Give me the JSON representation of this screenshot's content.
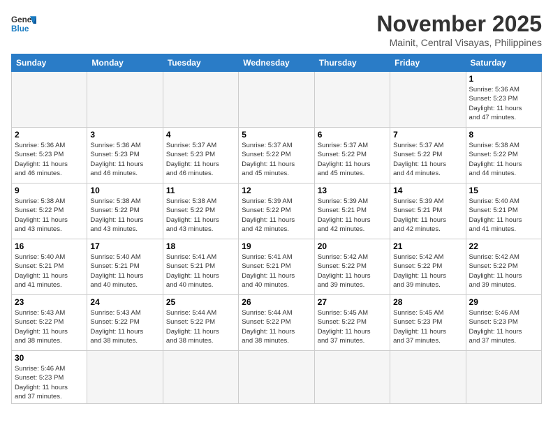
{
  "header": {
    "logo_general": "General",
    "logo_blue": "Blue",
    "month_title": "November 2025",
    "subtitle": "Mainit, Central Visayas, Philippines"
  },
  "weekdays": [
    "Sunday",
    "Monday",
    "Tuesday",
    "Wednesday",
    "Thursday",
    "Friday",
    "Saturday"
  ],
  "weeks": [
    [
      {
        "day": "",
        "info": ""
      },
      {
        "day": "",
        "info": ""
      },
      {
        "day": "",
        "info": ""
      },
      {
        "day": "",
        "info": ""
      },
      {
        "day": "",
        "info": ""
      },
      {
        "day": "",
        "info": ""
      },
      {
        "day": "1",
        "info": "Sunrise: 5:36 AM\nSunset: 5:23 PM\nDaylight: 11 hours\nand 47 minutes."
      }
    ],
    [
      {
        "day": "2",
        "info": "Sunrise: 5:36 AM\nSunset: 5:23 PM\nDaylight: 11 hours\nand 46 minutes."
      },
      {
        "day": "3",
        "info": "Sunrise: 5:36 AM\nSunset: 5:23 PM\nDaylight: 11 hours\nand 46 minutes."
      },
      {
        "day": "4",
        "info": "Sunrise: 5:37 AM\nSunset: 5:23 PM\nDaylight: 11 hours\nand 46 minutes."
      },
      {
        "day": "5",
        "info": "Sunrise: 5:37 AM\nSunset: 5:22 PM\nDaylight: 11 hours\nand 45 minutes."
      },
      {
        "day": "6",
        "info": "Sunrise: 5:37 AM\nSunset: 5:22 PM\nDaylight: 11 hours\nand 45 minutes."
      },
      {
        "day": "7",
        "info": "Sunrise: 5:37 AM\nSunset: 5:22 PM\nDaylight: 11 hours\nand 44 minutes."
      },
      {
        "day": "8",
        "info": "Sunrise: 5:38 AM\nSunset: 5:22 PM\nDaylight: 11 hours\nand 44 minutes."
      }
    ],
    [
      {
        "day": "9",
        "info": "Sunrise: 5:38 AM\nSunset: 5:22 PM\nDaylight: 11 hours\nand 43 minutes."
      },
      {
        "day": "10",
        "info": "Sunrise: 5:38 AM\nSunset: 5:22 PM\nDaylight: 11 hours\nand 43 minutes."
      },
      {
        "day": "11",
        "info": "Sunrise: 5:38 AM\nSunset: 5:22 PM\nDaylight: 11 hours\nand 43 minutes."
      },
      {
        "day": "12",
        "info": "Sunrise: 5:39 AM\nSunset: 5:22 PM\nDaylight: 11 hours\nand 42 minutes."
      },
      {
        "day": "13",
        "info": "Sunrise: 5:39 AM\nSunset: 5:21 PM\nDaylight: 11 hours\nand 42 minutes."
      },
      {
        "day": "14",
        "info": "Sunrise: 5:39 AM\nSunset: 5:21 PM\nDaylight: 11 hours\nand 42 minutes."
      },
      {
        "day": "15",
        "info": "Sunrise: 5:40 AM\nSunset: 5:21 PM\nDaylight: 11 hours\nand 41 minutes."
      }
    ],
    [
      {
        "day": "16",
        "info": "Sunrise: 5:40 AM\nSunset: 5:21 PM\nDaylight: 11 hours\nand 41 minutes."
      },
      {
        "day": "17",
        "info": "Sunrise: 5:40 AM\nSunset: 5:21 PM\nDaylight: 11 hours\nand 40 minutes."
      },
      {
        "day": "18",
        "info": "Sunrise: 5:41 AM\nSunset: 5:21 PM\nDaylight: 11 hours\nand 40 minutes."
      },
      {
        "day": "19",
        "info": "Sunrise: 5:41 AM\nSunset: 5:21 PM\nDaylight: 11 hours\nand 40 minutes."
      },
      {
        "day": "20",
        "info": "Sunrise: 5:42 AM\nSunset: 5:22 PM\nDaylight: 11 hours\nand 39 minutes."
      },
      {
        "day": "21",
        "info": "Sunrise: 5:42 AM\nSunset: 5:22 PM\nDaylight: 11 hours\nand 39 minutes."
      },
      {
        "day": "22",
        "info": "Sunrise: 5:42 AM\nSunset: 5:22 PM\nDaylight: 11 hours\nand 39 minutes."
      }
    ],
    [
      {
        "day": "23",
        "info": "Sunrise: 5:43 AM\nSunset: 5:22 PM\nDaylight: 11 hours\nand 38 minutes."
      },
      {
        "day": "24",
        "info": "Sunrise: 5:43 AM\nSunset: 5:22 PM\nDaylight: 11 hours\nand 38 minutes."
      },
      {
        "day": "25",
        "info": "Sunrise: 5:44 AM\nSunset: 5:22 PM\nDaylight: 11 hours\nand 38 minutes."
      },
      {
        "day": "26",
        "info": "Sunrise: 5:44 AM\nSunset: 5:22 PM\nDaylight: 11 hours\nand 38 minutes."
      },
      {
        "day": "27",
        "info": "Sunrise: 5:45 AM\nSunset: 5:22 PM\nDaylight: 11 hours\nand 37 minutes."
      },
      {
        "day": "28",
        "info": "Sunrise: 5:45 AM\nSunset: 5:23 PM\nDaylight: 11 hours\nand 37 minutes."
      },
      {
        "day": "29",
        "info": "Sunrise: 5:46 AM\nSunset: 5:23 PM\nDaylight: 11 hours\nand 37 minutes."
      }
    ],
    [
      {
        "day": "30",
        "info": "Sunrise: 5:46 AM\nSunset: 5:23 PM\nDaylight: 11 hours\nand 37 minutes."
      },
      {
        "day": "",
        "info": ""
      },
      {
        "day": "",
        "info": ""
      },
      {
        "day": "",
        "info": ""
      },
      {
        "day": "",
        "info": ""
      },
      {
        "day": "",
        "info": ""
      },
      {
        "day": "",
        "info": ""
      }
    ]
  ]
}
